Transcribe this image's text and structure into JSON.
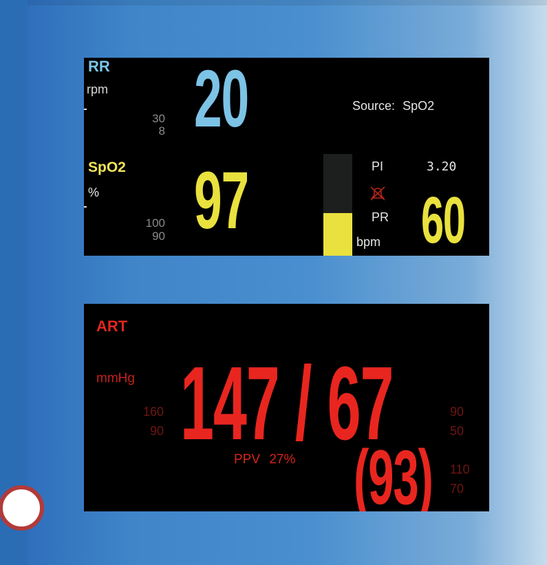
{
  "rr": {
    "label": "RR",
    "unit": "rpm",
    "alarm_high": "30",
    "alarm_low": "8",
    "value": "20",
    "source_label": "Source:",
    "source_value": "SpO2"
  },
  "spo2": {
    "label": "SpO2",
    "unit": "%",
    "alarm_high": "100",
    "alarm_low": "90",
    "value": "97",
    "signal_bar_fraction": 0.42
  },
  "pi": {
    "label": "PI",
    "value": "3.20"
  },
  "pr": {
    "label": "PR",
    "unit": "bpm",
    "value": "60",
    "alarm_icon": "alarm-off-bell-icon"
  },
  "art": {
    "label": "ART",
    "unit": "mmHg",
    "value": "147 / 67",
    "mean": "(93)",
    "sys_alarm_high": "160",
    "sys_alarm_low": "90",
    "dia_alarm_high": "90",
    "dia_alarm_low": "50",
    "mean_alarm_high": "110",
    "mean_alarm_low": "70",
    "ppv_label": "PPV",
    "ppv_value": "27%"
  },
  "colors": {
    "rr": "#7cc3e6",
    "spo2": "#e9e13e",
    "art": "#e8261f",
    "background": "#2b6fb8"
  }
}
